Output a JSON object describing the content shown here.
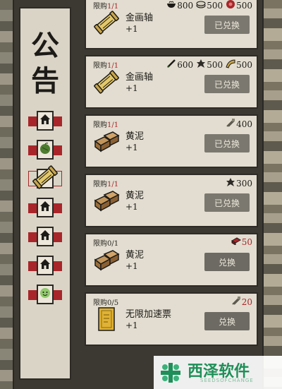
{
  "sidebar": {
    "title_line1": "公",
    "title_line2": "告",
    "tabs": [
      {
        "icon": "house-icon",
        "style": "filled"
      },
      {
        "icon": "melon-icon",
        "style": "filled"
      },
      {
        "icon": "scroll-icon",
        "style": "outline"
      },
      {
        "icon": "house-icon",
        "style": "filled"
      },
      {
        "icon": "house-icon",
        "style": "filled"
      },
      {
        "icon": "house-icon",
        "style": "filled"
      },
      {
        "icon": "smile-icon",
        "style": "filled"
      }
    ]
  },
  "items": [
    {
      "limit_prefix": "限购",
      "limit_used": "1/1",
      "used_red": true,
      "name": "金画轴",
      "qty": "+1",
      "icon": "scroll-icon",
      "button": "已兑换",
      "active": false,
      "costs": [
        {
          "icon": "bowl-icon",
          "value": "800",
          "red": false
        },
        {
          "icon": "coin-icon",
          "value": "500",
          "red": false
        },
        {
          "icon": "flower-icon",
          "value": "500",
          "red": false
        }
      ]
    },
    {
      "limit_prefix": "限购",
      "limit_used": "1/1",
      "used_red": true,
      "name": "金画轴",
      "qty": "+1",
      "icon": "scroll-icon",
      "button": "已兑换",
      "active": false,
      "costs": [
        {
          "icon": "brush-icon",
          "value": "600",
          "red": false
        },
        {
          "icon": "leaf-icon",
          "value": "500",
          "red": false
        },
        {
          "icon": "horn-icon",
          "value": "500",
          "red": false
        }
      ]
    },
    {
      "limit_prefix": "限购",
      "limit_used": "1/1",
      "used_red": true,
      "name": "黄泥",
      "qty": "+1",
      "icon": "clay-icon",
      "button": "已兑换",
      "active": false,
      "costs": [
        {
          "icon": "tools-icon",
          "value": "400",
          "red": false
        }
      ]
    },
    {
      "limit_prefix": "限购",
      "limit_used": "1/1",
      "used_red": true,
      "name": "黄泥",
      "qty": "+1",
      "icon": "clay-icon",
      "button": "已兑换",
      "active": false,
      "costs": [
        {
          "icon": "leaf-icon",
          "value": "300",
          "red": false
        }
      ]
    },
    {
      "limit_prefix": "限购",
      "limit_used": "0/1",
      "used_red": false,
      "name": "黄泥",
      "qty": "+1",
      "icon": "clay-icon",
      "button": "兑换",
      "active": true,
      "costs": [
        {
          "icon": "brick-icon",
          "value": "50",
          "red": true
        }
      ]
    },
    {
      "limit_prefix": "限购",
      "limit_used": "0/5",
      "used_red": false,
      "name": "无限加速票",
      "qty": "+1",
      "icon": "ticket-icon",
      "button": "兑换",
      "active": true,
      "costs": [
        {
          "icon": "tools-icon",
          "value": "20",
          "red": true
        }
      ]
    }
  ],
  "watermark": {
    "text": "西泽软件",
    "sub": "SEEDSOFCHANGE"
  },
  "colors": {
    "red": "#a8262a",
    "panel": "#e2ddd0",
    "button": "#7b7870"
  }
}
